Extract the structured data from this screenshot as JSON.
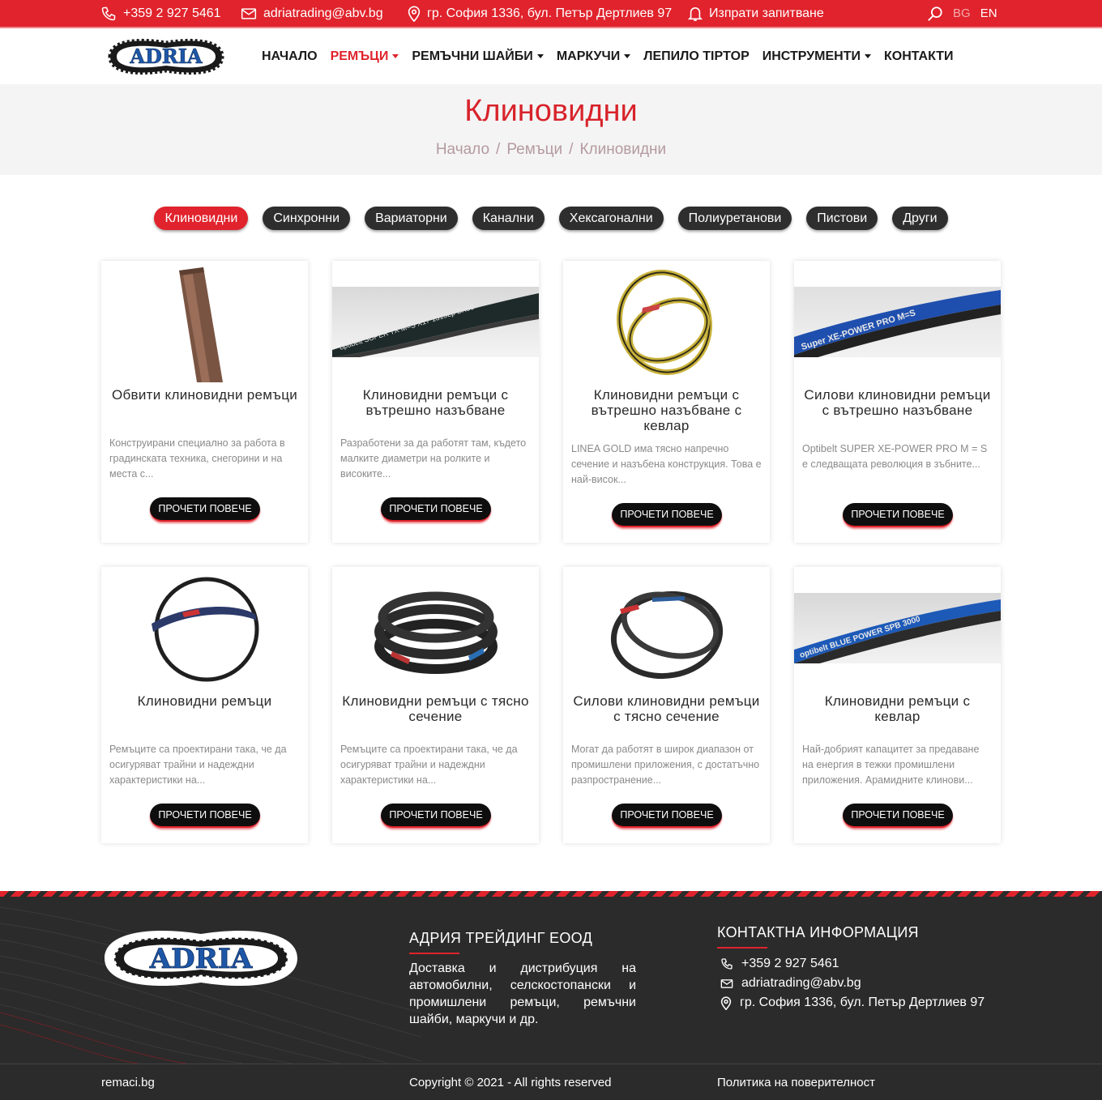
{
  "topbar": {
    "phone": "+359 2 927 5461",
    "email": "adriatrading@abv.bg",
    "address": "гр. София 1336, бул. Петър Дертлиев 97",
    "inquiry": "Изпрати запитване",
    "lang_bg": "BG",
    "lang_en": "EN"
  },
  "logo": {
    "text": "ADRIA"
  },
  "nav": {
    "items": [
      {
        "label": "НАЧАЛО"
      },
      {
        "label": "РЕМЪЦИ"
      },
      {
        "label": "РЕМЪЧНИ ШАЙБИ"
      },
      {
        "label": "МАРКУЧИ"
      },
      {
        "label": "ЛЕПИЛО TIPTOP"
      },
      {
        "label": "ИНСТРУМЕНТИ"
      },
      {
        "label": "КОНТАКТИ"
      }
    ]
  },
  "page": {
    "title": "Клиновидни",
    "breadcrumb": [
      "Начало",
      "Ремъци",
      "Клиновидни"
    ],
    "breadcrumb_sep": "/"
  },
  "filters": [
    "Клиновидни",
    "Синхронни",
    "Вариаторни",
    "Канални",
    "Хексагонални",
    "Полиуретанови",
    "Пистови",
    "Други"
  ],
  "read_more": "ПРОЧЕТИ ПОВЕЧЕ",
  "products": [
    {
      "title": "Обвити клиновидни ремъци",
      "desc": "Конструирани специално за работа в градинската техника, снегорини и на места с..."
    },
    {
      "title": "Клиновидни ремъци с вътрешно назъбване",
      "desc": "Разработени за да работят там, където малките диаметри на ролките и високите..."
    },
    {
      "title": "Клиновидни ремъци с вътрешно назъбване с кевлар",
      "desc": "LINEA GOLD има тясно напречно сечение и назъбена конструкция. Това е най-висок..."
    },
    {
      "title": "Силови клиновидни ремъци с вътрешно назъбване",
      "desc": "Optibelt SUPER XE-POWER PRO M = S е следващата революция в зъбните..."
    },
    {
      "title": "Клиновидни ремъци",
      "desc": "Ремъците са проектирани така, че да осигуряват трайни и надеждни характеристики на..."
    },
    {
      "title": "Клиновидни ремъци с тясно сечение",
      "desc": "Ремъците са проектирани така, че да осигуряват трайни и надеждни характеристики на..."
    },
    {
      "title": "Силови клиновидни ремъци с тясно сечение",
      "desc": "Могат да работят в широк диапазон от промишлени приложения, с достатъчно разпространение..."
    },
    {
      "title": "Клиновидни ремъци с кевлар",
      "desc": "Най-добрият капацитет за предаване на енергия в тежки промишлени приложения. Арамидните клинови..."
    }
  ],
  "product_print": {
    "p2": "optibelt SUPER TX M=S  X17  1315Lp  BX50",
    "p4": "Super XE-POWER PRO M=S",
    "p8": "optibelt BLUE POWER  SPB 3000"
  },
  "footer": {
    "company_heading": "АДРИЯ ТРЕЙДИНГ ЕООД",
    "about": "Доставка и дистрибуция на автомобилни, селскостопански и промишлени ремъци, ремъчни шайби, маркучи и др.",
    "contact_heading": "КОНТАКТНА ИНФОРМАЦИЯ",
    "phone": "+359 2 927 5461",
    "email": "adriatrading@abv.bg",
    "address": "гр. София 1336, бул. Петър Дертлиев 97",
    "site": "remaci.bg",
    "copyright": "Copyright © 2021 - All rights reserved",
    "privacy": "Политика на поверителност"
  },
  "colors": {
    "brand_red": "#e0232c",
    "dark": "#2b2b2b",
    "logo_blue": "#1e57a8"
  }
}
